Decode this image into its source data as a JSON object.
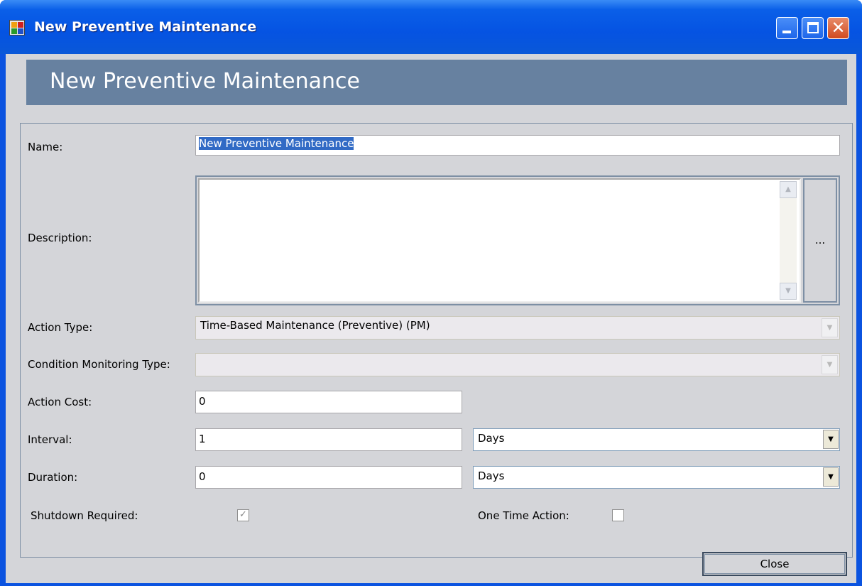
{
  "window": {
    "title": "New Preventive Maintenance",
    "minimize_glyph": "",
    "close_glyph": "✕"
  },
  "banner": {
    "title": "New Preventive Maintenance"
  },
  "form": {
    "name": {
      "label": "Name:",
      "value": "New Preventive Maintenance"
    },
    "description": {
      "label": "Description:",
      "value": "",
      "button_label": "..."
    },
    "action_type": {
      "label": "Action Type:",
      "value": "Time-Based Maintenance (Preventive) (PM)",
      "enabled": false
    },
    "condition_monitoring_type": {
      "label": "Condition Monitoring Type:",
      "value": "",
      "enabled": false
    },
    "action_cost": {
      "label": "Action Cost:",
      "value": "0"
    },
    "interval": {
      "label": "Interval:",
      "value": "1",
      "unit": "Days"
    },
    "duration": {
      "label": "Duration:",
      "value": "0",
      "unit": "Days"
    },
    "shutdown_required": {
      "label": "Shutdown Required:",
      "checked": true
    },
    "one_time_action": {
      "label": "One Time Action:",
      "checked": false
    }
  },
  "footer": {
    "close_label": "Close"
  },
  "icons": {
    "app": "app-icon",
    "dropdown": "▼",
    "scroll_up": "▲",
    "scroll_down": "▼",
    "check": "✓"
  },
  "colors": {
    "titlebar": "#0553e2",
    "banner": "#6781a0",
    "client": "#d4d5d9",
    "selection": "#316ac5"
  }
}
